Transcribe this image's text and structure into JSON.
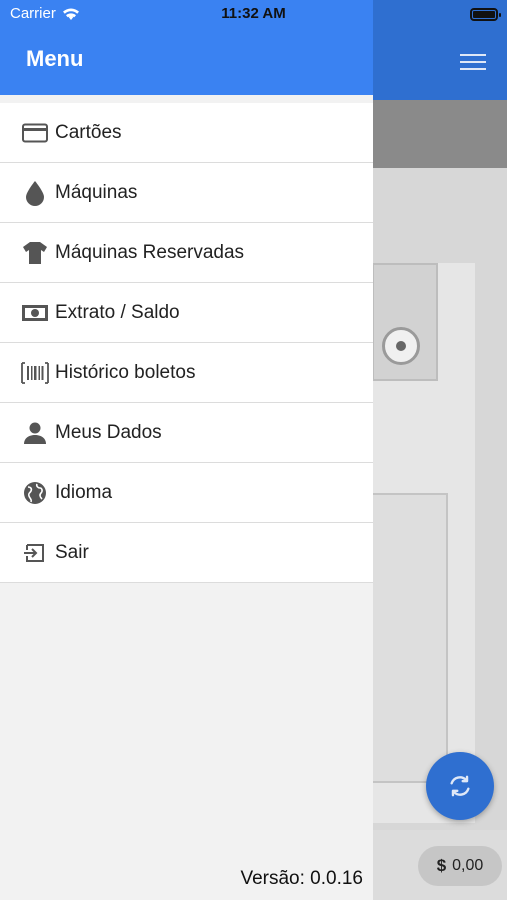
{
  "status_bar": {
    "carrier": "Carrier",
    "time": "11:32 AM",
    "battery_level": 1.0
  },
  "drawer": {
    "title": "Menu",
    "items": [
      {
        "label": "Cartões",
        "icon": "credit-card-icon"
      },
      {
        "label": "Máquinas",
        "icon": "water-drop-icon"
      },
      {
        "label": "Máquinas Reservadas",
        "icon": "t-shirt-icon"
      },
      {
        "label": "Extrato / Saldo",
        "icon": "money-icon"
      },
      {
        "label": "Histórico boletos",
        "icon": "barcode-icon"
      },
      {
        "label": "Meus Dados",
        "icon": "user-icon"
      },
      {
        "label": "Idioma",
        "icon": "globe-icon"
      },
      {
        "label": "Sair",
        "icon": "sign-out-icon"
      }
    ],
    "version": "Versão: 0.0.16"
  },
  "background": {
    "balance_currency": "$",
    "balance_value": "0,00",
    "refresh_icon": "refresh-icon",
    "menu_icon": "hamburger-icon"
  },
  "colors": {
    "drawer_header": "#3a82f2",
    "app_header": "#2f6fd0",
    "fab": "#2f6fd0"
  }
}
